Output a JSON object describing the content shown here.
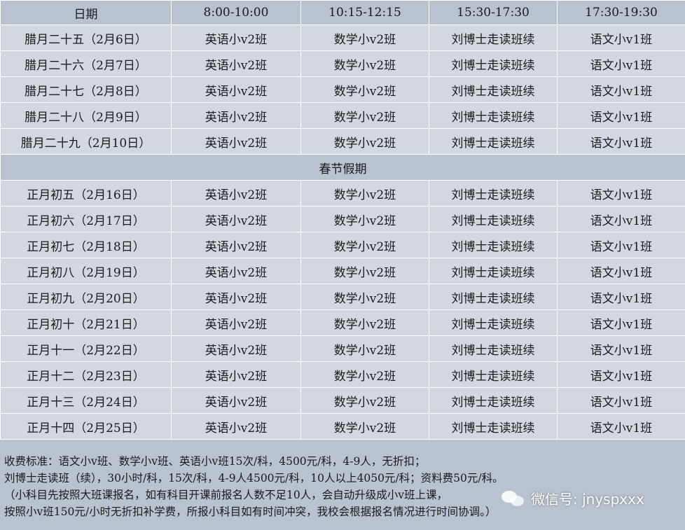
{
  "table": {
    "headers": [
      "日期",
      "8:00-10:00",
      "10:15-12:15",
      "15:30-17:30",
      "17:30-19:30"
    ],
    "rows_before": [
      [
        "腊月二十五（2月6日）",
        "英语小v2班",
        "数学小v2班",
        "刘博士走读班续",
        "语文小v1班"
      ],
      [
        "腊月二十六（2月7日）",
        "英语小v2班",
        "数学小v2班",
        "刘博士走读班续",
        "语文小v1班"
      ],
      [
        "腊月二十七（2月8日）",
        "英语小v2班",
        "数学小v2班",
        "刘博士走读班续",
        "语文小v1班"
      ],
      [
        "腊月二十八（2月9日）",
        "英语小v2班",
        "数学小v2班",
        "刘博士走读班续",
        "语文小v1班"
      ],
      [
        "腊月二十九（2月10日）",
        "英语小v2班",
        "数学小v2班",
        "刘博士走读班续",
        "语文小v1班"
      ]
    ],
    "holiday_label": "春节假期",
    "rows_after": [
      [
        "正月初五（2月16日）",
        "英语小v2班",
        "数学小v2班",
        "刘博士走读班续",
        "语文小v1班"
      ],
      [
        "正月初六（2月17日）",
        "英语小v2班",
        "数学小v2班",
        "刘博士走读班续",
        "语文小v1班"
      ],
      [
        "正月初七（2月18日）",
        "英语小v2班",
        "数学小v2班",
        "刘博士走读班续",
        "语文小v1班"
      ],
      [
        "正月初八（2月19日）",
        "英语小v2班",
        "数学小v2班",
        "刘博士走读班续",
        "语文小v1班"
      ],
      [
        "正月初九（2月20日）",
        "英语小v2班",
        "数学小v2班",
        "刘博士走读班续",
        "语文小v1班"
      ],
      [
        "正月初十（2月21日）",
        "英语小v2班",
        "数学小v2班",
        "刘博士走读班续",
        "语文小v1班"
      ],
      [
        "正月十一（2月22日）",
        "英语小v2班",
        "数学小v2班",
        "刘博士走读班续",
        "语文小v1班"
      ],
      [
        "正月十二（2月23日）",
        "英语小v2班",
        "数学小v2班",
        "刘博士走读班续",
        "语文小v1班"
      ],
      [
        "正月十三（2月24日）",
        "英语小v2班",
        "数学小v2班",
        "刘博士走读班续",
        "语文小v1班"
      ],
      [
        "正月十四（2月25日）",
        "英语小v2班",
        "数学小v2班",
        "刘博士走读班续",
        "语文小v1班"
      ]
    ]
  },
  "notes": [
    "收费标准：语文小v班、数学小v班、英语小v班15次/科，4500元/科，4-9人，无折扣；",
    "刘博士走读班（续），30小时/科，15次/科，4-9人4500元/科，10人以上4050元/科；资料费50元/科。",
    "（小科目先按照大班课报名，如有科目开课前报名人数不足10人，会自动升级成小v班上课，",
    "按照小v班150元/小时无折扣补学费，所报小科目如有时间冲突，我校会根据报名情况进行时间协调。）"
  ],
  "watermark": {
    "icon": "wechat-icon",
    "text": "微信号: jnyspxxx"
  },
  "colors": {
    "header_bg": "#b9c3cf",
    "row_bg": "#d3d8e0",
    "border": "#ffffff"
  }
}
